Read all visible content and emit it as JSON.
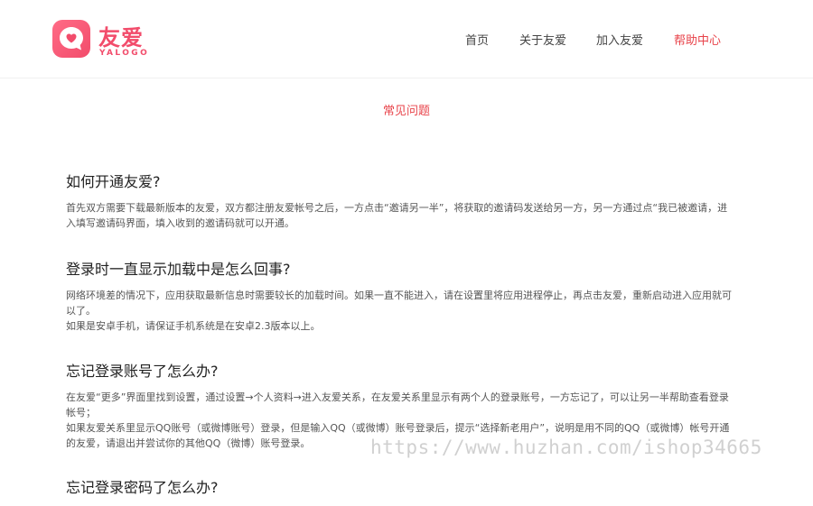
{
  "brand": {
    "name": "友爱",
    "sub": "YALOGO",
    "color": "#f24c6b"
  },
  "nav": {
    "items": [
      {
        "label": "首页"
      },
      {
        "label": "关于友爱"
      },
      {
        "label": "加入友爱"
      },
      {
        "label": "帮助中心"
      }
    ],
    "active_color": "#e8434a"
  },
  "section_title": "常见问题",
  "faqs": [
    {
      "question": "如何开通友爱?",
      "answer": [
        "首先双方需要下载最新版本的友爱，双方都注册友爱帐号之后，一方点击“邀请另一半”，将获取的邀请码发送给另一方，另一方通过点“我已被邀请，进入填写邀请码界面，填入收到的邀请码就可以开通。"
      ]
    },
    {
      "question": "登录时一直显示加载中是怎么回事?",
      "answer": [
        "网络环境差的情况下，应用获取最新信息时需要较长的加载时间。如果一直不能进入，请在设置里将应用进程停止，再点击友爱，重新启动进入应用就可以了。",
        "如果是安卓手机，请保证手机系统是在安卓2.3版本以上。"
      ]
    },
    {
      "question": "忘记登录账号了怎么办?",
      "answer": [
        "在友爱“更多”界面里找到设置，通过设置→个人资料→进入友爱关系，在友爱关系里显示有两个人的登录账号，一方忘记了，可以让另一半帮助查看登录帐号；",
        "如果友爱关系里显示QQ账号（或微博账号）登录，但是输入QQ（或微博）账号登录后，提示“选择新老用户”，说明是用不同的QQ（或微博）帐号开通的友爱，请退出并尝试你的其他QQ（微博）账号登录。"
      ]
    },
    {
      "question": "忘记登录密码了怎么办?",
      "answer": []
    }
  ],
  "watermark": "https://www.huzhan.com/ishop34665"
}
